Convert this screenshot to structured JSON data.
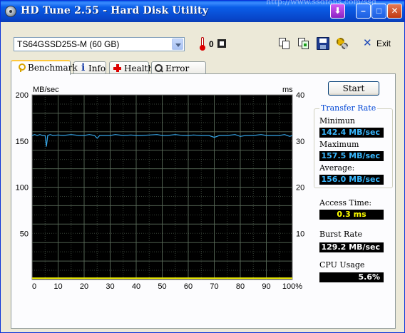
{
  "window": {
    "title": "HD Tune 2.55 - Hard Disk Utility",
    "background_text": "http://www.ssdfans.com/ssd"
  },
  "toolbar": {
    "drive": "TS64GSSD25S-M (60 GB)",
    "temperature": "0",
    "exit_label": "Exit"
  },
  "tabs": [
    {
      "label": "Benchmark",
      "active": true
    },
    {
      "label": "Info",
      "active": false
    },
    {
      "label": "Health",
      "active": false
    },
    {
      "label": "Error Scan",
      "active": false
    }
  ],
  "benchmark": {
    "start_label": "Start",
    "transfer_rate": {
      "title": "Transfer Rate",
      "minimum_label": "Minimun",
      "minimum": "142.4 MB/sec",
      "maximum_label": "Maximum",
      "maximum": "157.5 MB/sec",
      "average_label": "Average:",
      "average": "156.0 MB/sec"
    },
    "access_time_label": "Access Time:",
    "access_time": "0.3 ms",
    "burst_rate_label": "Burst Rate",
    "burst_rate": "129.2 MB/sec",
    "cpu_usage_label": "CPU Usage",
    "cpu_usage": "5.6%"
  },
  "colors": {
    "chart_bg": "#000000",
    "grid": "#5a6b5a",
    "transfer_line": "#35a6e8",
    "access_line": "#e8e800"
  },
  "chart_data": {
    "type": "line",
    "ylabel": "MB/sec",
    "y2label": "ms",
    "ylim": [
      0,
      200
    ],
    "y2lim": [
      0,
      40
    ],
    "xlim": [
      0,
      100
    ],
    "y_ticks": [
      0,
      50,
      100,
      150,
      200
    ],
    "y_tick_labels": [
      "",
      "50",
      "100",
      "150",
      "200"
    ],
    "y2_ticks": [
      0,
      10,
      20,
      30,
      40
    ],
    "y2_tick_labels": [
      "",
      "10",
      "20",
      "30",
      "40"
    ],
    "x_ticks": [
      0,
      10,
      20,
      30,
      40,
      50,
      60,
      70,
      80,
      90,
      100
    ],
    "x_tick_labels": [
      "0",
      "10",
      "20",
      "30",
      "40",
      "50",
      "60",
      "70",
      "80",
      "90",
      "100%"
    ],
    "grid": true,
    "series": [
      {
        "axis": "left",
        "x": [
          0,
          1,
          2,
          3,
          4,
          5,
          5.5,
          6,
          7,
          8,
          10,
          12,
          15,
          18,
          20,
          22,
          24,
          25,
          26,
          28,
          30,
          32,
          35,
          38,
          40,
          42,
          45,
          48,
          50,
          52,
          55,
          58,
          60,
          62,
          65,
          68,
          70,
          72,
          75,
          78,
          80,
          82,
          85,
          88,
          90,
          92,
          95,
          97,
          98,
          99,
          100
        ],
        "y": [
          156,
          157,
          156,
          157,
          156,
          156,
          144,
          156,
          157,
          156,
          156.5,
          156,
          157,
          156,
          156,
          157,
          156,
          153,
          156,
          156,
          156,
          157,
          156,
          156.5,
          156,
          156,
          156.5,
          157,
          156,
          156,
          157,
          156,
          156,
          156.5,
          156,
          156,
          154,
          156,
          156,
          157,
          155,
          156,
          156,
          157,
          156,
          156,
          156,
          157,
          156,
          155,
          156
        ]
      },
      {
        "axis": "right",
        "x": [
          0,
          5,
          10,
          15,
          20,
          25,
          30,
          35,
          40,
          45,
          50,
          55,
          60,
          65,
          70,
          75,
          80,
          85,
          90,
          95,
          100
        ],
        "y": [
          0.3,
          0.3,
          0.3,
          0.3,
          0.3,
          0.3,
          0.3,
          0.3,
          0.3,
          0.3,
          0.3,
          0.3,
          0.3,
          0.3,
          0.3,
          0.3,
          0.3,
          0.3,
          0.3,
          0.3,
          0.3
        ]
      }
    ]
  }
}
